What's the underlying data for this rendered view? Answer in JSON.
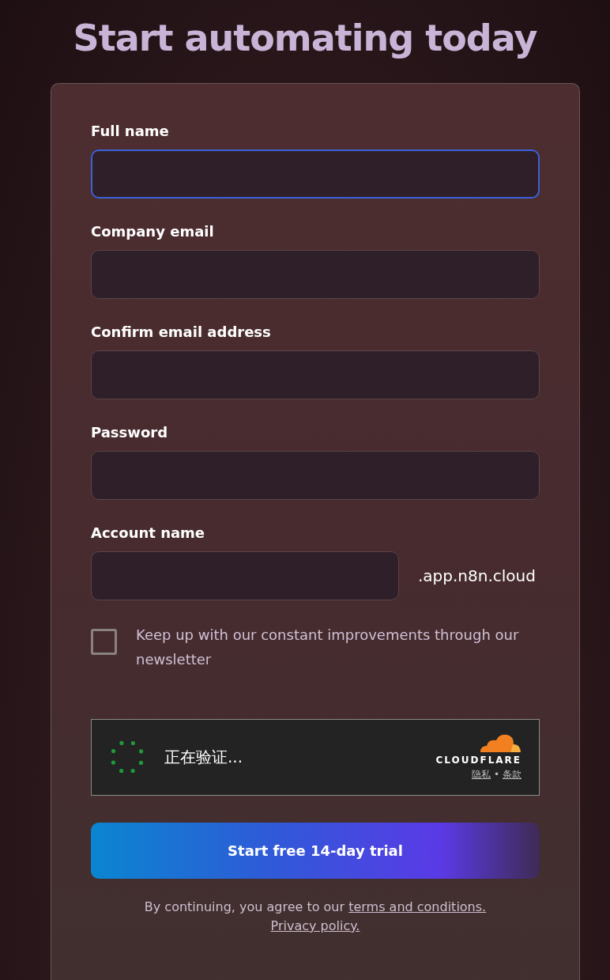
{
  "heading": "Start automating today",
  "fields": [
    {
      "label": "Full name",
      "focused": true
    },
    {
      "label": "Company email",
      "focused": false
    },
    {
      "label": "Confirm email address",
      "focused": false
    },
    {
      "label": "Password",
      "focused": false
    },
    {
      "label": "Account name",
      "focused": false,
      "suffix": ".app.n8n.cloud"
    }
  ],
  "newsletter": {
    "label": "Keep up with our constant improvements through our newsletter",
    "checked": false
  },
  "captcha": {
    "status": "正在验证...",
    "brand": "CLOUDFLARE",
    "links": [
      "隐私",
      "条款"
    ],
    "separator": "•"
  },
  "submit": "Start free 14-day trial",
  "legal": {
    "text": "By continuing, you agree to our ",
    "links": [
      "terms and conditions.",
      "Privacy policy."
    ]
  }
}
